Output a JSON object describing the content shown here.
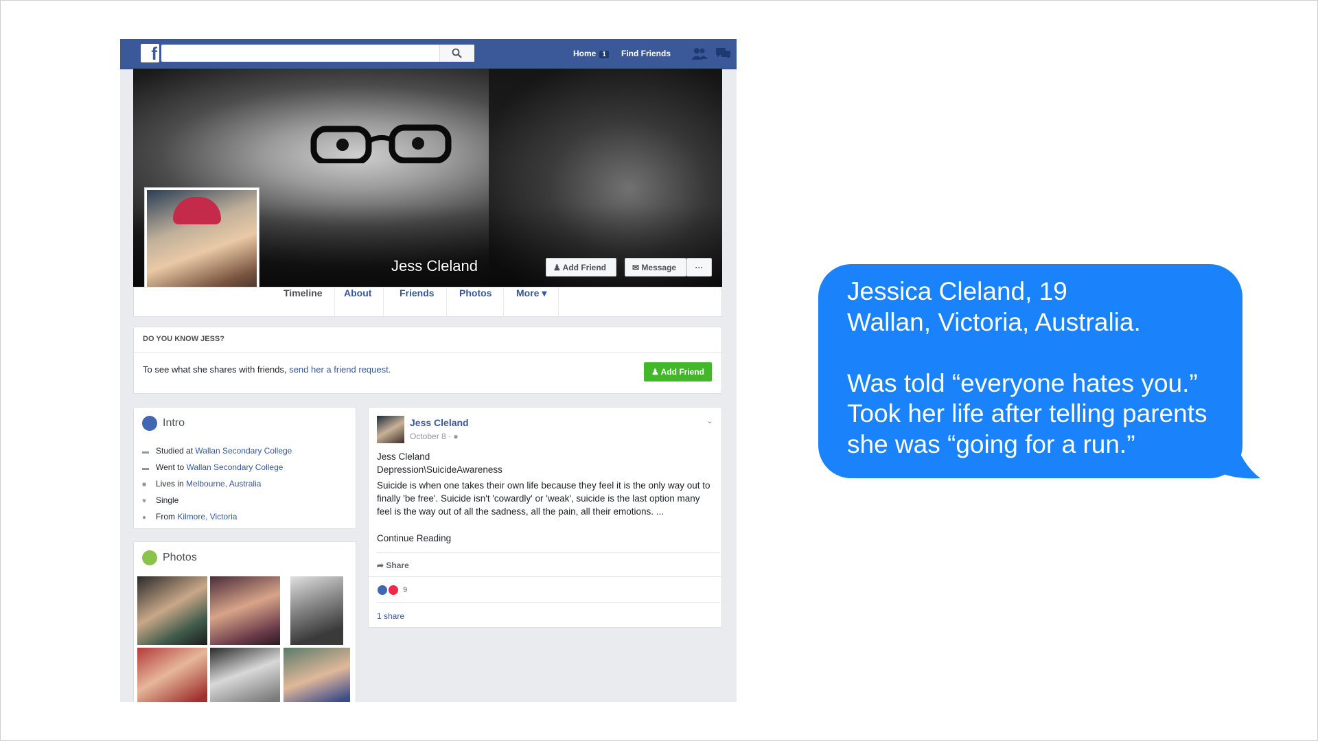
{
  "fb": {
    "logo": "f",
    "search_icon": "search-icon",
    "nav": {
      "home": "Home",
      "home_badge": "1",
      "find_friends": "Find Friends"
    },
    "profile_name": "Jess Cleland",
    "cover_buttons": {
      "add_friend": "Add Friend",
      "message": "Message",
      "more": "···"
    },
    "tabs": [
      "Timeline",
      "About",
      "Friends",
      "Photos",
      "More ▾"
    ],
    "know": {
      "title": "DO YOU KNOW JESS?",
      "text": "To see what she shares with friends,",
      "link": "send her a friend request.",
      "button": "Add Friend"
    },
    "intro": {
      "title": "Intro",
      "items": [
        {
          "prefix": "Studied at",
          "link": "Wallan Secondary College",
          "icon": "graduation-icon"
        },
        {
          "prefix": "Went to",
          "link": "Wallan Secondary College",
          "icon": "graduation-icon"
        },
        {
          "prefix": "Lives in",
          "link": "Melbourne, Australia",
          "icon": "home-icon"
        },
        {
          "prefix": "Single",
          "link": "",
          "icon": "heart-icon"
        },
        {
          "prefix": "From",
          "link": "Kilmore, Victoria",
          "icon": "location-icon"
        }
      ]
    },
    "photos": {
      "title": "Photos"
    },
    "post": {
      "author": "Jess Cleland",
      "date": "October 8 · ",
      "line1": "Jess Cleland",
      "line2": "Depression\\SuicideAwareness",
      "body": "Suicide is when one takes their own life because they feel it is the only way out to finally 'be free'. Suicide isn't 'cowardly' or 'weak', suicide is the last option many feel is the way out of all the sadness, all the pain, all their emotions. ...",
      "continue": "Continue Reading",
      "share": "Share",
      "reactions_count": "9",
      "shares": "1 share"
    }
  },
  "bubble": {
    "text": "Jessica Cleland, 19\nWallan, Victoria, Australia.\n\nWas told “everyone hates you.”\nTook her life after telling parents\nshe was “going for a run.”",
    "color": "#1a82fb"
  }
}
